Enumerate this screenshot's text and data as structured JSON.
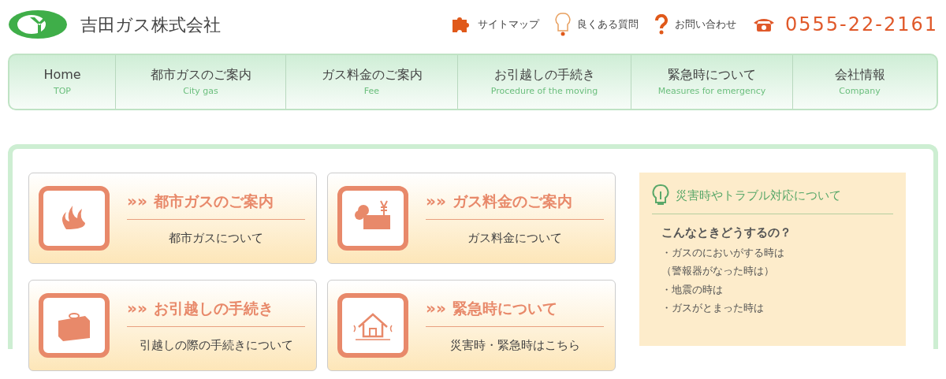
{
  "header": {
    "company": "吉田ガス株式会社",
    "links": [
      {
        "kind": "puzzle",
        "label": "サイトマップ"
      },
      {
        "kind": "bulb",
        "label": "良くある質問"
      },
      {
        "kind": "question",
        "label": "お問い合わせ"
      }
    ],
    "phone": "0555-22-2161"
  },
  "nav": [
    {
      "label": "Home",
      "sub": "TOP"
    },
    {
      "label": "都市ガスのご案内",
      "sub": "City gas"
    },
    {
      "label": "ガス料金のご案内",
      "sub": "Fee"
    },
    {
      "label": "お引越しの手続き",
      "sub": "Procedure of the moving"
    },
    {
      "label": "緊急時について",
      "sub": "Measures for emergency"
    },
    {
      "label": "会社情報",
      "sub": "Company"
    }
  ],
  "cards": [
    {
      "kind": "flame",
      "title": "都市ガスのご案内",
      "text": "都市ガスについて"
    },
    {
      "kind": "money",
      "title": "ガス料金のご案内",
      "text": "ガス料金について"
    },
    {
      "kind": "box",
      "title": "お引越しの手続き",
      "text": "引越しの際の手続きについて"
    },
    {
      "kind": "house",
      "title": "緊急時について",
      "text": "災害時・緊急時はこちら"
    }
  ],
  "arrow": "»»",
  "sidebox": {
    "title": "災害時やトラブル対応について",
    "heading": "こんなときどうするの？",
    "lines": [
      "・ガスのにおいがする時は",
      "（警報器がなった時は）",
      "・地震の時は",
      "・ガスがとまった時は"
    ]
  }
}
